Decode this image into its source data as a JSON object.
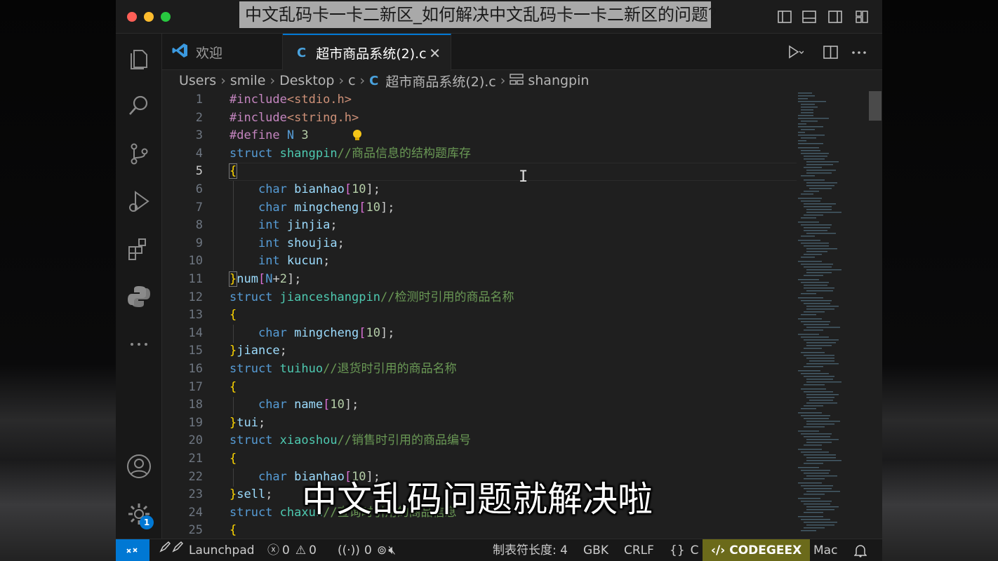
{
  "video_title": "中文乱码卡一卡二新区_如何解决中文乱码卡一卡二新区的问题？",
  "tabs": [
    {
      "label": "欢迎"
    },
    {
      "label": "超市商品系统(2).c",
      "icon": "C"
    }
  ],
  "breadcrumb": [
    "Users",
    "smile",
    "Desktop",
    "c",
    "超市商品系统(2).c",
    "shangpin"
  ],
  "breadcrumb_file_icon": "C",
  "code_lines": [
    {
      "n": "1"
    },
    {
      "n": "2"
    },
    {
      "n": "3"
    },
    {
      "n": "4"
    },
    {
      "n": "5"
    },
    {
      "n": "6"
    },
    {
      "n": "7"
    },
    {
      "n": "8"
    },
    {
      "n": "9"
    },
    {
      "n": "10"
    },
    {
      "n": "11"
    },
    {
      "n": "12"
    },
    {
      "n": "13"
    },
    {
      "n": "14"
    },
    {
      "n": "15"
    },
    {
      "n": "16"
    },
    {
      "n": "17"
    },
    {
      "n": "18"
    },
    {
      "n": "19"
    },
    {
      "n": "20"
    },
    {
      "n": "21"
    },
    {
      "n": "22"
    },
    {
      "n": "23"
    },
    {
      "n": "24"
    },
    {
      "n": "25"
    }
  ],
  "code": {
    "l1": {
      "a": "#include",
      "b": "<stdio.h>"
    },
    "l2": {
      "a": "#include",
      "b": "<string.h>"
    },
    "l3": {
      "a": "#define",
      "b": "N",
      "c": "3"
    },
    "l4": {
      "a": "struct",
      "b": "shangpin",
      "c": "//商品信息的结构题库存"
    },
    "l5": {
      "a": "{"
    },
    "l6": {
      "a": "char",
      "b": "bianhao",
      "c": "[",
      "d": "10",
      "e": "];"
    },
    "l7": {
      "a": "char",
      "b": "mingcheng",
      "c": "[",
      "d": "10",
      "e": "];"
    },
    "l8": {
      "a": "int",
      "b": "jinjia",
      "c": ";"
    },
    "l9": {
      "a": "int",
      "b": "shoujia",
      "c": ";"
    },
    "l10": {
      "a": "int",
      "b": "kucun",
      "c": ";"
    },
    "l11": {
      "a": "}",
      "b": "num",
      "c": "[",
      "d": "N",
      "e": "+",
      "f": "2",
      "g": "];"
    },
    "l12": {
      "a": "struct",
      "b": "jianceshangpin",
      "c": "//检测时引用的商品名称"
    },
    "l13": {
      "a": "{"
    },
    "l14": {
      "a": "char",
      "b": "mingcheng",
      "c": "[",
      "d": "10",
      "e": "];"
    },
    "l15": {
      "a": "}",
      "b": "jiance",
      "c": ";"
    },
    "l16": {
      "a": "struct",
      "b": "tuihuo",
      "c": "//退货时引用的商品名称"
    },
    "l17": {
      "a": "{"
    },
    "l18": {
      "a": "char",
      "b": "name",
      "c": "[",
      "d": "10",
      "e": "];"
    },
    "l19": {
      "a": "}",
      "b": "tui",
      "c": ";"
    },
    "l20": {
      "a": "struct",
      "b": "xiaoshou",
      "c": "//销售时引用的商品编号"
    },
    "l21": {
      "a": "{"
    },
    "l22": {
      "a": "char",
      "b": "bianhao",
      "c": "[",
      "d": "10",
      "e": "];"
    },
    "l23": {
      "a": "}",
      "b": "sell",
      "c": ";"
    },
    "l24": {
      "a": "struct",
      "b": "chaxun",
      "c": "//查询时引用的商品信息"
    },
    "l25": {
      "a": "{"
    }
  },
  "subtitle": "中文乱码问题就解决啦",
  "status": {
    "launchpad": "Launchpad",
    "errors": "0",
    "warnings": "0",
    "ports": "0",
    "tab_size": "制表符长度: 4",
    "encoding": "GBK",
    "eol": "CRLF",
    "language": "C",
    "codegeex": "CODEGEEX",
    "platform": "Mac"
  },
  "notification_count": "1",
  "colors": {
    "accent": "#0078d4",
    "editor_bg": "#1f1f1f",
    "keyword": "#569cd6",
    "preprocessor": "#c586c0",
    "type_name": "#4ec9b0",
    "comment": "#6a9955"
  }
}
